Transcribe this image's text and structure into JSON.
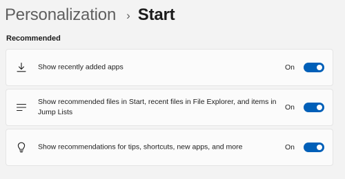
{
  "breadcrumb": {
    "parent": "Personalization",
    "separator": "›",
    "current": "Start"
  },
  "section": {
    "heading": "Recommended"
  },
  "settings": [
    {
      "icon": "download-icon",
      "label": "Show recently added apps",
      "state": "On",
      "enabled": true
    },
    {
      "icon": "list-icon",
      "label": "Show recommended files in Start, recent files in File Explorer, and items in Jump Lists",
      "state": "On",
      "enabled": true
    },
    {
      "icon": "lightbulb-icon",
      "label": "Show recommendations for tips, shortcuts, new apps, and more",
      "state": "On",
      "enabled": true
    }
  ],
  "colors": {
    "toggle_on": "#005fb8",
    "card_background": "#fbfbfb",
    "page_background": "#f3f3f3"
  }
}
